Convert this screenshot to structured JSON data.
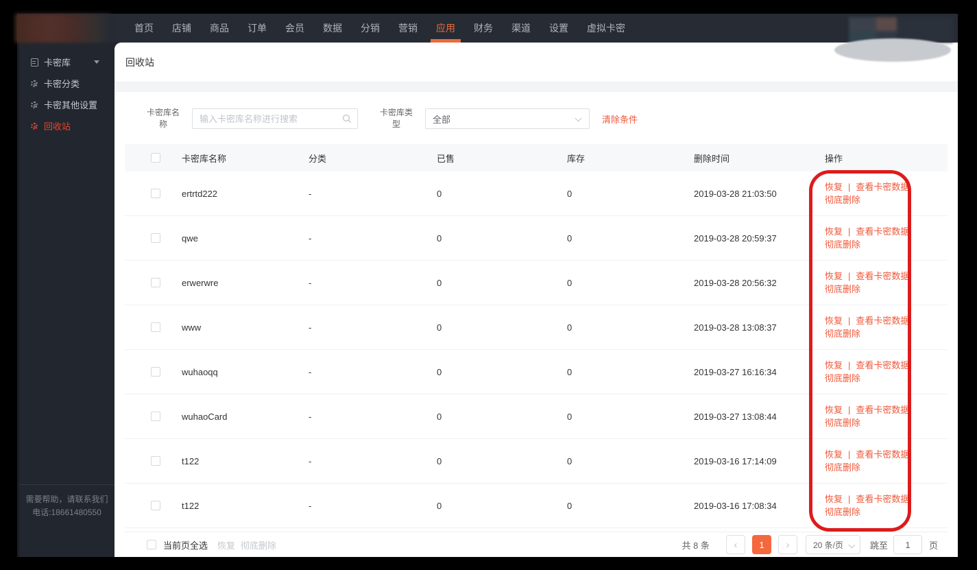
{
  "topnav": {
    "items": [
      "首页",
      "店铺",
      "商品",
      "订单",
      "会员",
      "数据",
      "分销",
      "营销",
      "应用",
      "财务",
      "渠道",
      "设置",
      "虚拟卡密"
    ],
    "active_index": 8
  },
  "sidebar": {
    "items": [
      {
        "label": "卡密库",
        "icon": "card-library-icon",
        "caret": true,
        "active": false
      },
      {
        "label": "卡密分类",
        "icon": "gear-icon",
        "caret": false,
        "active": false
      },
      {
        "label": "卡密其他设置",
        "icon": "gear-icon",
        "caret": false,
        "active": false
      },
      {
        "label": "回收站",
        "icon": "gear-icon",
        "caret": false,
        "active": true
      }
    ],
    "help_line1": "需要帮助，请联系我们",
    "help_line2": "电话:18661480550"
  },
  "page": {
    "title": "回收站"
  },
  "filters": {
    "name_label": "卡密库名称",
    "name_placeholder": "输入卡密库名称进行搜索",
    "type_label": "卡密库类型",
    "type_value": "全部",
    "clear_label": "清除条件"
  },
  "table": {
    "columns": [
      "卡密库名称",
      "分类",
      "已售",
      "库存",
      "删除时间",
      "操作"
    ],
    "rows": [
      {
        "name": "ertrtd222",
        "category": "-",
        "sold": "0",
        "stock": "0",
        "deleted_at": "2019-03-28 21:03:50"
      },
      {
        "name": "qwe",
        "category": "-",
        "sold": "0",
        "stock": "0",
        "deleted_at": "2019-03-28 20:59:37"
      },
      {
        "name": "erwerwre",
        "category": "-",
        "sold": "0",
        "stock": "0",
        "deleted_at": "2019-03-28 20:56:32"
      },
      {
        "name": "www",
        "category": "-",
        "sold": "0",
        "stock": "0",
        "deleted_at": "2019-03-28 13:08:37"
      },
      {
        "name": "wuhaoqq",
        "category": "-",
        "sold": "0",
        "stock": "0",
        "deleted_at": "2019-03-27 16:16:34"
      },
      {
        "name": "wuhaoCard",
        "category": "-",
        "sold": "0",
        "stock": "0",
        "deleted_at": "2019-03-27 13:08:44"
      },
      {
        "name": "t122",
        "category": "-",
        "sold": "0",
        "stock": "0",
        "deleted_at": "2019-03-16 17:14:09"
      },
      {
        "name": "t122",
        "category": "-",
        "sold": "0",
        "stock": "0",
        "deleted_at": "2019-03-16 17:08:34"
      }
    ]
  },
  "row_actions": {
    "restore": "恢复",
    "divider": "|",
    "view": "查看卡密数据",
    "delete": "彻底删除"
  },
  "footer": {
    "select_all": "当前页全选",
    "batch_restore": "恢复",
    "batch_delete": "彻底删除",
    "total": "共 8 条",
    "prev": "‹",
    "next": "›",
    "current_page": "1",
    "page_size": "20 条/页",
    "jump_label": "跳至",
    "jump_value": "1",
    "page_unit": "页"
  },
  "colors": {
    "accent_orange": "#f0583a",
    "nav_active_orange": "#ed6a3c",
    "sidebar_active_red": "#e8472c",
    "pagination_active_bg": "#f4683e",
    "annotation_red": "#dc1c1c"
  }
}
